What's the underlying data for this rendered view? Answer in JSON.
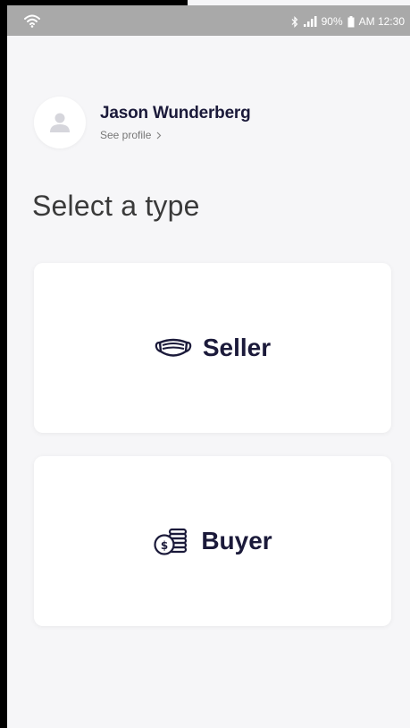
{
  "status_bar": {
    "battery": "90%",
    "time": "AM 12:30",
    "icons": [
      "wifi-icon",
      "bluetooth-icon",
      "signal-icon",
      "battery-icon"
    ]
  },
  "profile": {
    "name": "Jason Wunderberg",
    "link_label": "See profile",
    "avatar_icon": "person-icon"
  },
  "main": {
    "title": "Select a type",
    "options": [
      {
        "label": "Seller",
        "icon": "mask-icon"
      },
      {
        "label": "Buyer",
        "icon": "coins-icon"
      }
    ]
  },
  "colors": {
    "background": "#f6f6f8",
    "status_bar": "#a9a9a9",
    "card": "#ffffff",
    "text_dark": "#1b1a3a"
  }
}
